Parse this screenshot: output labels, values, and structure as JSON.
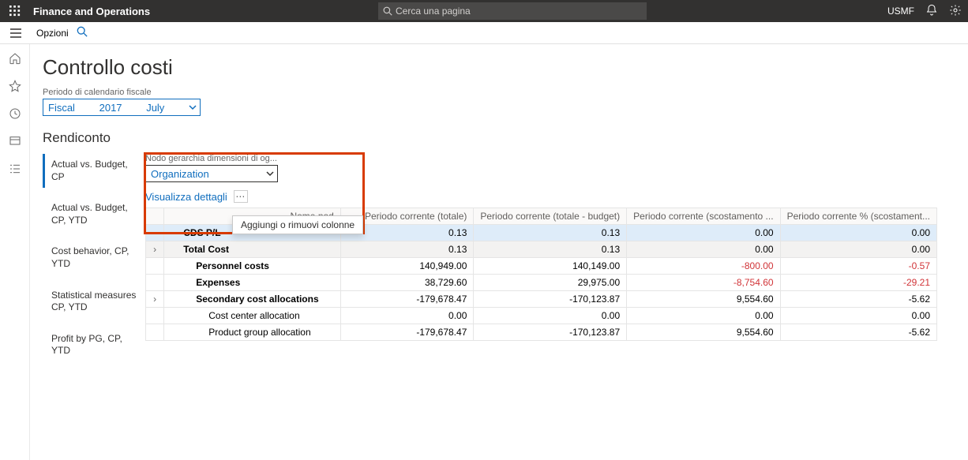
{
  "header": {
    "app_title": "Finance and Operations",
    "search_placeholder": "Cerca una pagina",
    "entity": "USMF"
  },
  "actionbar": {
    "options": "Opzioni"
  },
  "page": {
    "title": "Controllo costi",
    "fiscal_label": "Periodo di calendario fiscale",
    "fiscal_calendar": "Fiscal",
    "fiscal_year": "2017",
    "fiscal_month": "July",
    "section_title": "Rendiconto"
  },
  "tabs": [
    "Actual vs. Budget, CP",
    "Actual vs. Budget, CP, YTD",
    "Cost behavior, CP, YTD",
    "Statistical measures CP, YTD",
    "Profit by PG, CP, YTD"
  ],
  "detail": {
    "hierarchy_label": "Nodo gerarchia dimensioni di og...",
    "hierarchy_value": "Organization",
    "view_details": "Visualizza dettagli",
    "tooltip": "Aggiungi o rimuovi colonne"
  },
  "grid": {
    "columns": [
      "Nome nod",
      "Periodo corrente (totale)",
      "Periodo corrente (totale - budget)",
      "Periodo corrente (scostamento ...",
      "Periodo corrente % (scostament..."
    ],
    "rows": [
      {
        "name": "CDS P/L",
        "indent": 1,
        "bold": true,
        "expander": "",
        "selected": true,
        "v": [
          "0.13",
          "0.13",
          "0.00",
          "0.00"
        ],
        "neg": [
          false,
          false,
          false,
          false
        ]
      },
      {
        "name": "Total Cost",
        "indent": 1,
        "bold": true,
        "expander": "›",
        "subhead": true,
        "v": [
          "0.13",
          "0.13",
          "0.00",
          "0.00"
        ],
        "neg": [
          false,
          false,
          false,
          false
        ]
      },
      {
        "name": "Personnel costs",
        "indent": 2,
        "bold": true,
        "expander": "",
        "v": [
          "140,949.00",
          "140,149.00",
          "-800.00",
          "-0.57"
        ],
        "neg": [
          false,
          false,
          true,
          true
        ]
      },
      {
        "name": "Expenses",
        "indent": 2,
        "bold": true,
        "expander": "",
        "v": [
          "38,729.60",
          "29,975.00",
          "-8,754.60",
          "-29.21"
        ],
        "neg": [
          false,
          false,
          true,
          true
        ]
      },
      {
        "name": "Secondary cost allocations",
        "indent": 2,
        "bold": true,
        "expander": "›",
        "v": [
          "-179,678.47",
          "-170,123.87",
          "9,554.60",
          "-5.62"
        ],
        "neg": [
          false,
          false,
          false,
          false
        ]
      },
      {
        "name": "Cost center allocation",
        "indent": 3,
        "bold": false,
        "expander": "",
        "v": [
          "0.00",
          "0.00",
          "0.00",
          "0.00"
        ],
        "neg": [
          false,
          false,
          false,
          false
        ]
      },
      {
        "name": "Product group allocation",
        "indent": 3,
        "bold": false,
        "expander": "",
        "v": [
          "-179,678.47",
          "-170,123.87",
          "9,554.60",
          "-5.62"
        ],
        "neg": [
          false,
          false,
          false,
          false
        ]
      }
    ]
  }
}
